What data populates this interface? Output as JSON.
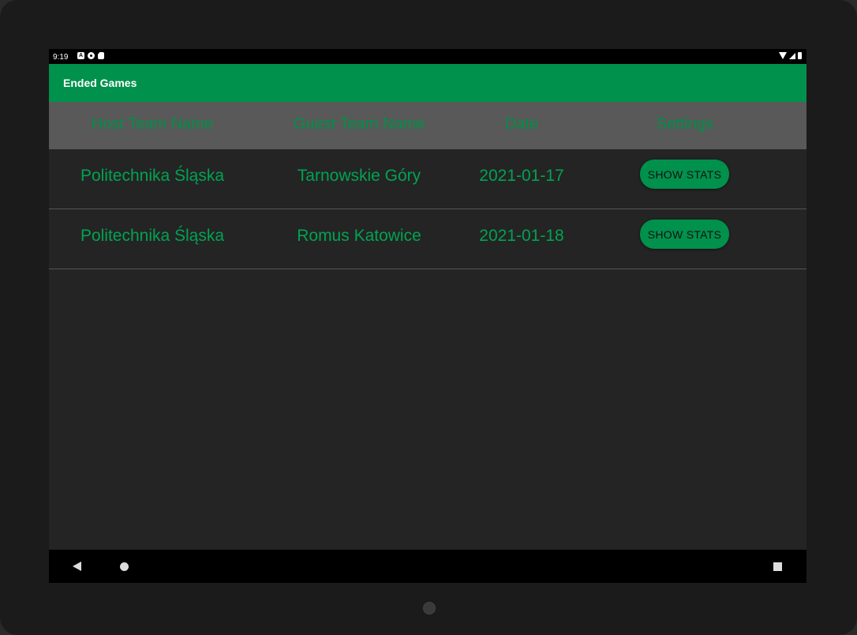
{
  "status_bar": {
    "time": "9:19",
    "left_icons": [
      "notification-a-icon",
      "notification-p-icon",
      "sd-card-icon"
    ],
    "right_icons": [
      "wifi-icon",
      "signal-icon",
      "battery-icon"
    ]
  },
  "app_bar": {
    "title": "Ended Games"
  },
  "table": {
    "headers": {
      "host": "Host Team Name",
      "guest": "Guest Team Name",
      "date": "Date",
      "settings": "Settings"
    },
    "rows": [
      {
        "host": "Politechnika Śląska",
        "guest": "Tarnowskie Góry",
        "date": "2021-01-17",
        "button": "SHOW STATS"
      },
      {
        "host": "Politechnika Śląska",
        "guest": "Romus Katowice",
        "date": "2021-01-18",
        "button": "SHOW STATS"
      }
    ]
  },
  "nav_bar": {
    "icons": [
      "back-icon",
      "home-icon",
      "recents-icon"
    ]
  },
  "colors": {
    "accent": "#00914c",
    "text_green": "#00a352",
    "header_bg": "#595959",
    "content_bg": "#242424"
  }
}
